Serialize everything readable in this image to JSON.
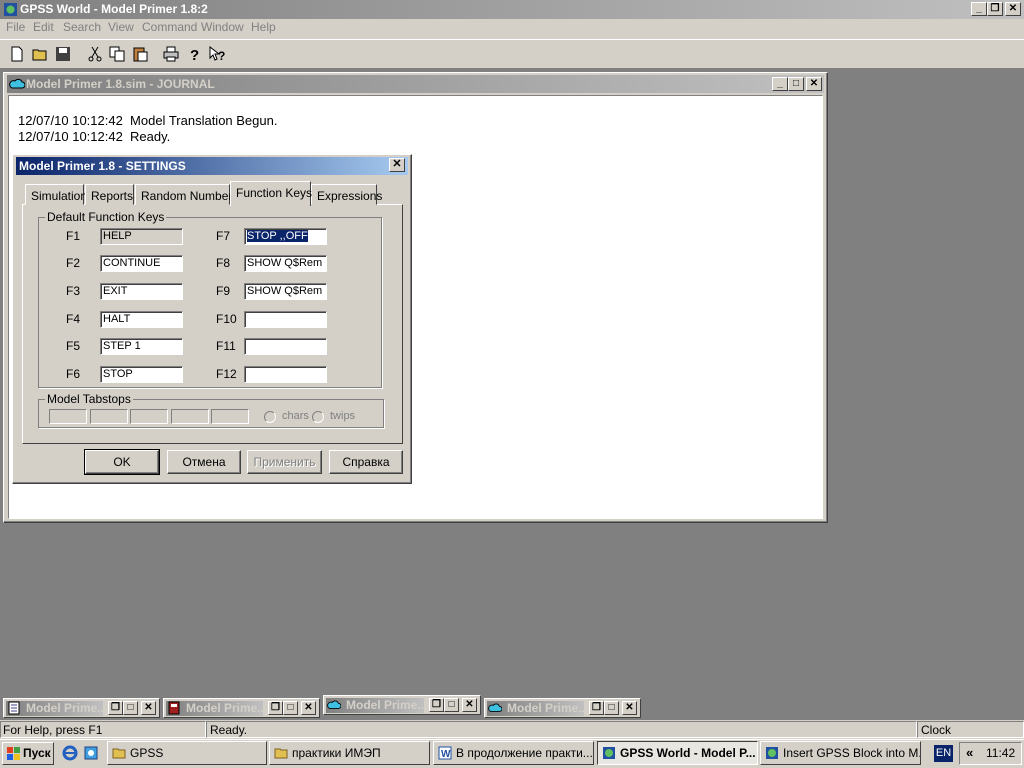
{
  "app": {
    "title": "GPSS World - Model Primer 1.8:2",
    "menu": [
      "File",
      "Edit",
      "Search",
      "View",
      "Command",
      "Window",
      "Help"
    ]
  },
  "toolbar": {
    "icons": [
      "new-file-icon",
      "open-folder-icon",
      "save-icon",
      "cut-icon",
      "copy-icon",
      "paste-icon",
      "print-icon",
      "help-icon",
      "context-help-icon"
    ]
  },
  "journal": {
    "title": "Model Primer 1.8.sim  -  JOURNAL",
    "lines": [
      "12/07/10 10:12:42  Model Translation Begun.",
      "12/07/10 10:12:42  Ready."
    ]
  },
  "settings": {
    "title": "Model Primer 1.8 - SETTINGS",
    "tabs": [
      "Simulation",
      "Reports",
      "Random Numbers",
      "Function Keys",
      "Expressions"
    ],
    "active_tab": "Function Keys",
    "group_default": "Default Function Keys",
    "keys_left": [
      {
        "key": "F1",
        "value": "HELP"
      },
      {
        "key": "F2",
        "value": "CONTINUE"
      },
      {
        "key": "F3",
        "value": "EXIT"
      },
      {
        "key": "F4",
        "value": "HALT"
      },
      {
        "key": "F5",
        "value": "STEP 1"
      },
      {
        "key": "F6",
        "value": "STOP"
      }
    ],
    "keys_right": [
      {
        "key": "F7",
        "value": "STOP ,,OFF"
      },
      {
        "key": "F8",
        "value": "SHOW Q$Rem"
      },
      {
        "key": "F9",
        "value": "SHOW Q$Rem"
      },
      {
        "key": "F10",
        "value": ""
      },
      {
        "key": "F11",
        "value": ""
      },
      {
        "key": "F12",
        "value": ""
      }
    ],
    "group_tabstops": "Model Tabstops",
    "radio_chars": "chars",
    "radio_twips": "twips",
    "buttons": {
      "ok": "OK",
      "cancel": "Отмена",
      "apply": "Применить",
      "help": "Справка"
    }
  },
  "minimized": [
    {
      "label": "Model Prime...",
      "icon": "doc-icon"
    },
    {
      "label": "Model Prime...",
      "icon": "report-icon"
    },
    {
      "label": "Model Prime...",
      "icon": "cloud-icon"
    },
    {
      "label": "Model Prime...",
      "icon": "cloud-icon"
    }
  ],
  "statusbar": {
    "hint": "For Help, press F1",
    "state": "Ready.",
    "clock_label": "Clock"
  },
  "taskbar": {
    "start": "Пуск",
    "items": [
      "GPSS",
      "практики ИМЭП",
      "В продолжение практи...",
      "GPSS World - Model P...",
      "Insert GPSS Block into M..."
    ],
    "active_index": 3,
    "lang": "EN",
    "time": "11:42",
    "chevron": "«"
  },
  "colors": {
    "face": "#d4d0c8",
    "desktop": "#808080",
    "active_title": "#0a246a",
    "inactive_title": "#808080"
  }
}
